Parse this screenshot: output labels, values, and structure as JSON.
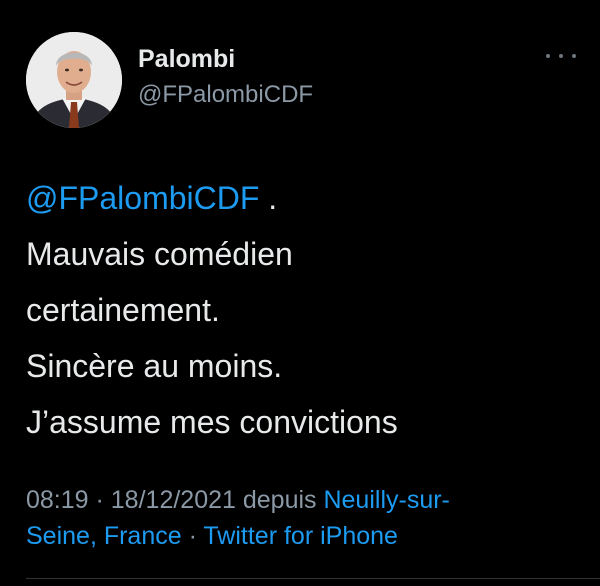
{
  "author": {
    "name": "Palombi",
    "handle": "@FPalombiCDF"
  },
  "tweet": {
    "mention": "@FPalombiCDF",
    "mention_suffix": " .",
    "lines": [
      "Mauvais comédien",
      "certainement.",
      "Sincère au moins.",
      "J’assume mes convictions"
    ]
  },
  "meta": {
    "time": "08:19",
    "sep1": " · ",
    "date": "18/12/2021",
    "depuis": " depuis ",
    "location_part1": "Neuilly-sur-",
    "location_part2": "Seine, France",
    "sep2": " · ",
    "source": "Twitter for iPhone"
  },
  "colors": {
    "background": "#000000",
    "text": "#e7e9ea",
    "secondary": "#8b98a5",
    "link": "#1d9bf0"
  },
  "icons": {
    "more": "more-horizontal-icon",
    "avatar": "profile-photo"
  }
}
